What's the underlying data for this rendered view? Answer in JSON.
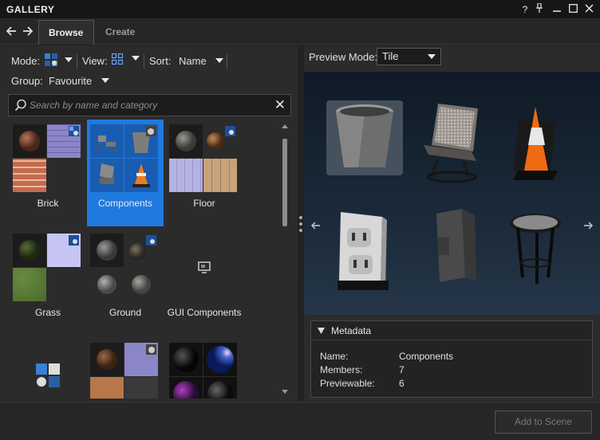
{
  "window": {
    "title": "GALLERY",
    "controls": [
      "help-icon",
      "pin-icon",
      "minimize-icon",
      "maximize-icon",
      "close-icon"
    ]
  },
  "tabs": [
    {
      "label": "Browse",
      "active": true
    },
    {
      "label": "Create",
      "active": false
    }
  ],
  "toolbar": {
    "mode_label": "Mode:",
    "view_label": "View:",
    "sort_label": "Sort:",
    "sort_value": "Name",
    "group_label": "Group:",
    "group_value": "Favourite"
  },
  "search": {
    "placeholder": "Search by name and category"
  },
  "gallery": {
    "items": [
      {
        "label": "Brick",
        "selected": false
      },
      {
        "label": "Components",
        "selected": true
      },
      {
        "label": "Floor",
        "selected": false
      },
      {
        "label": "Grass",
        "selected": false
      },
      {
        "label": "Ground",
        "selected": false
      },
      {
        "label": "GUI Components",
        "selected": false
      },
      {
        "label": "",
        "selected": false
      },
      {
        "label": "",
        "selected": false
      },
      {
        "label": "",
        "selected": false
      }
    ]
  },
  "preview": {
    "mode_label": "Preview Mode:",
    "mode_value": "Tile"
  },
  "metadata": {
    "title": "Metadata",
    "name_key": "Name:",
    "name_value": "Components",
    "members_key": "Members:",
    "members_value": "7",
    "previewable_key": "Previewable:",
    "previewable_value": "6"
  },
  "footer": {
    "add_button": "Add to Scene"
  },
  "colors": {
    "accent": "#1f7ae0",
    "background": "#2b2b2b"
  }
}
